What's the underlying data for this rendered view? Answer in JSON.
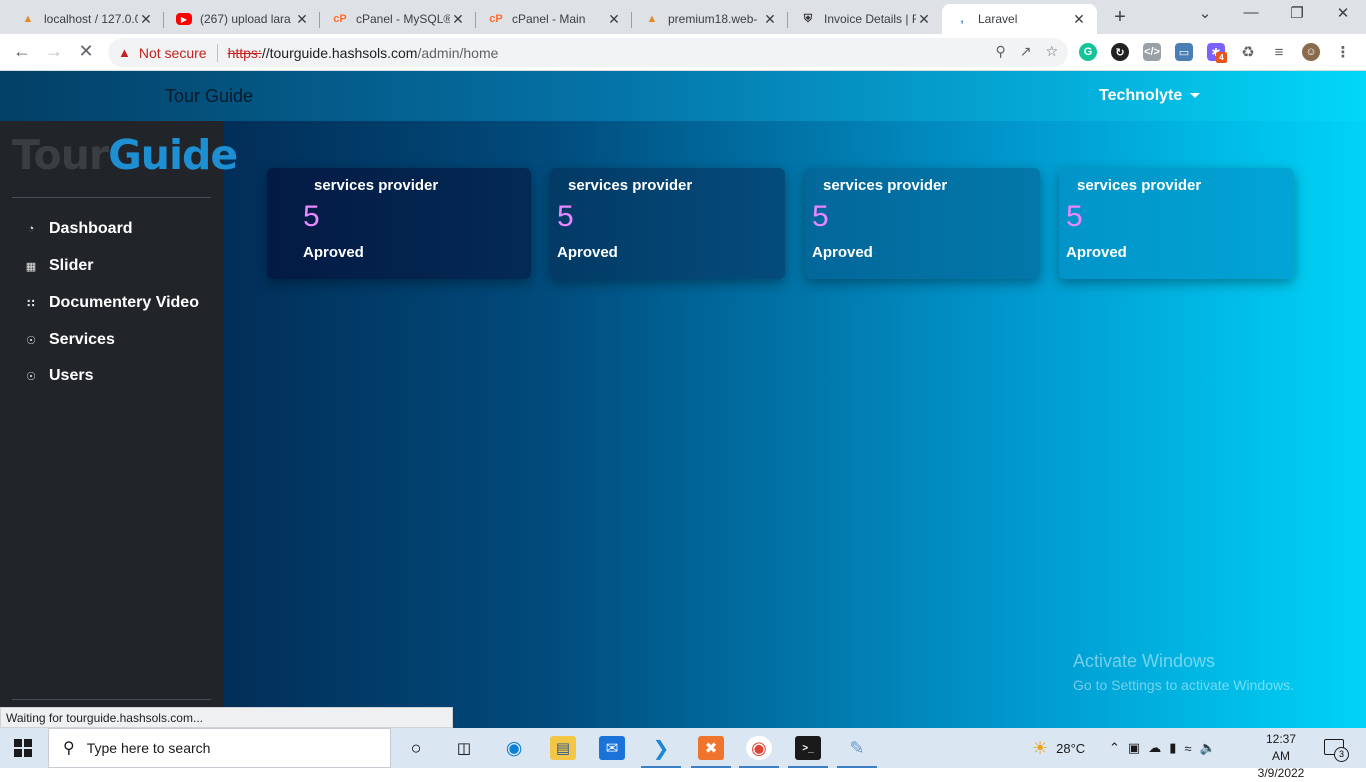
{
  "browser": {
    "tabs": [
      {
        "title": "localhost / 127.0.0",
        "icon": "phpmyadmin-icon"
      },
      {
        "title": "(267) upload lara",
        "icon": "youtube-icon"
      },
      {
        "title": "cPanel - MySQL®",
        "icon": "cpanel-icon"
      },
      {
        "title": "cPanel - Main",
        "icon": "cpanel-icon"
      },
      {
        "title": "premium18.web-",
        "icon": "phpmyadmin-icon"
      },
      {
        "title": "Invoice Details | F",
        "icon": "shield-icon"
      },
      {
        "title": "Laravel",
        "icon": "loading-icon"
      }
    ],
    "security_label": "Not secure",
    "url_scheme": "https:",
    "url_host": "//tourguide.hashsols.com",
    "url_path": "/admin/home",
    "extension_badge": "4",
    "status_text": "Waiting for tourguide.hashsols.com..."
  },
  "app": {
    "brand": "Tour Guide",
    "user": "Technolyte",
    "logo_part1": "Tour",
    "logo_part2": "Guide"
  },
  "sidebar": {
    "items": [
      {
        "label": "Dashboard",
        "icon": "dashboard-icon"
      },
      {
        "label": "Slider",
        "icon": "table-icon"
      },
      {
        "label": "Documentery Video",
        "icon": "grid-icon"
      },
      {
        "label": "Services",
        "icon": "user-circle-icon"
      },
      {
        "label": "Users",
        "icon": "user-circle-icon"
      }
    ]
  },
  "cards": [
    {
      "title": "services provider",
      "count": "5",
      "status": "Aproved"
    },
    {
      "title": "services provider",
      "count": "5",
      "status": "Aproved"
    },
    {
      "title": "services provider",
      "count": "5",
      "status": "Aproved"
    },
    {
      "title": "services provider",
      "count": "5",
      "status": "Aproved"
    }
  ],
  "watermark": {
    "title": "Activate Windows",
    "subtitle": "Go to Settings to activate Windows."
  },
  "taskbar": {
    "search_placeholder": "Type here to search",
    "temperature": "28°C",
    "time": "12:37 AM",
    "date": "3/9/2022",
    "notification_count": "3"
  },
  "colors": {
    "accent_number": "#e887ff",
    "logo_blue": "#1e8fd3",
    "sidebar_bg": "#212529"
  }
}
